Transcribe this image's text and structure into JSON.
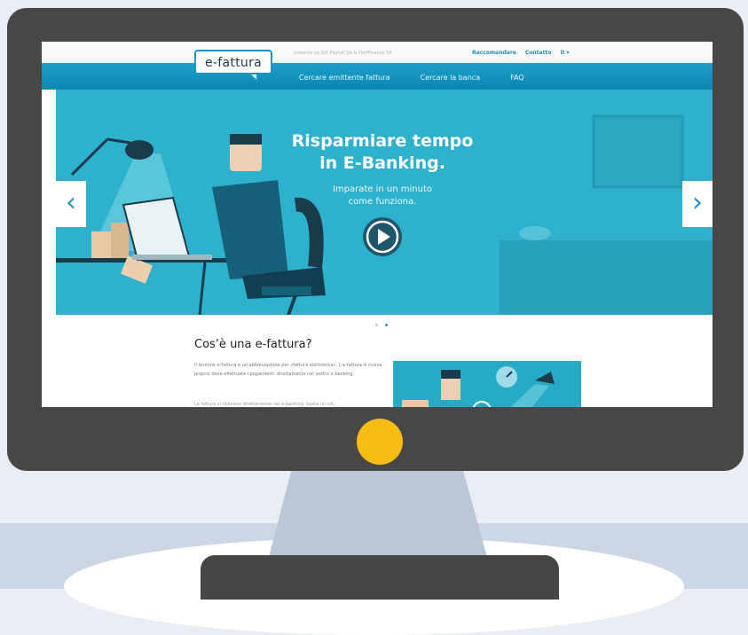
{
  "site": {
    "logo": "e-fattura",
    "powered_by": "powered by SIX Paynet SA & PostFinance SA",
    "top_links": [
      "Raccomandare",
      "Contatto",
      "it ▾"
    ],
    "nav": [
      "Cercare emittente fattura",
      "Cercare la banca",
      "FAQ"
    ]
  },
  "hero": {
    "title_line1": "Risparmiare tempo",
    "title_line2": "in E-Banking.",
    "subtitle_line1": "Imparate in un minuto",
    "subtitle_line2": "come funziona.",
    "prev_arrow": "‹",
    "next_arrow": "›",
    "slide_count": 2,
    "active_slide": 2
  },
  "section": {
    "title": "Cos’è una e-fattura?",
    "body": "Il termine e-fattura è un'abbreviazione per «fattura elettronica». L'e-fattura si riceve proprio dove effettuate i pagamenti: direttamente nel vostro e-banking.",
    "body2": "Le fatture si ricevono direttamente nel e-banking: basta un clic."
  },
  "colors": {
    "monitor": "#474747",
    "power_button": "#f8bd12",
    "brand_blue": "#1c94c4",
    "hero_bg": "#2eb1cd"
  },
  "icons": [
    "chevron-left-icon",
    "chevron-right-icon",
    "play-icon",
    "power-indicator-icon"
  ]
}
